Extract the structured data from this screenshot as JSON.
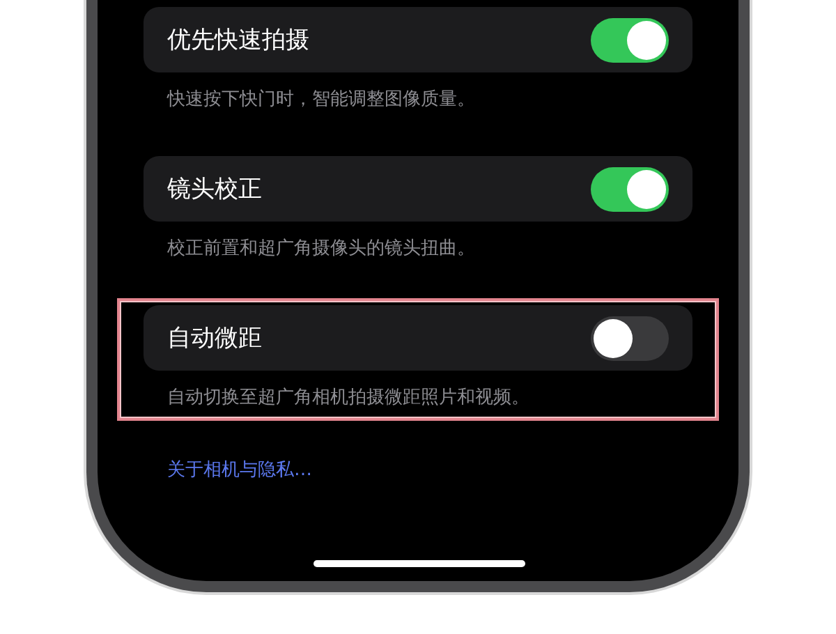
{
  "settings": [
    {
      "label": "优先快速拍摄",
      "on": true,
      "description": "快速按下快门时，智能调整图像质量。",
      "highlighted": false
    },
    {
      "label": "镜头校正",
      "on": true,
      "description": "校正前置和超广角摄像头的镜头扭曲。",
      "highlighted": false
    },
    {
      "label": "自动微距",
      "on": false,
      "description": "自动切换至超广角相机拍摄微距照片和视频。",
      "highlighted": true
    }
  ],
  "link": "关于相机与隐私…"
}
